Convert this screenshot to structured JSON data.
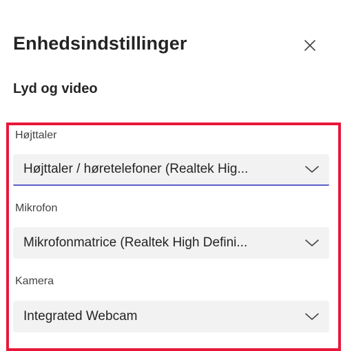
{
  "dialog": {
    "title": "Enhedsindstillinger",
    "section_title": "Lyd og video"
  },
  "fields": {
    "speaker": {
      "label": "Højttaler",
      "value": "Højttaler / høretelefoner (Realtek Hig..."
    },
    "microphone": {
      "label": "Mikrofon",
      "value": "Mikrofonmatrice (Realtek High Defini..."
    },
    "camera": {
      "label": "Kamera",
      "value": "Integrated Webcam"
    }
  },
  "icons": {
    "close": "close-icon",
    "chevron": "chevron-down-icon"
  },
  "colors": {
    "highlight_border": "#e8173a",
    "focus_underline": "#5b5fc7",
    "dropdown_bg": "#f2f2f2"
  }
}
